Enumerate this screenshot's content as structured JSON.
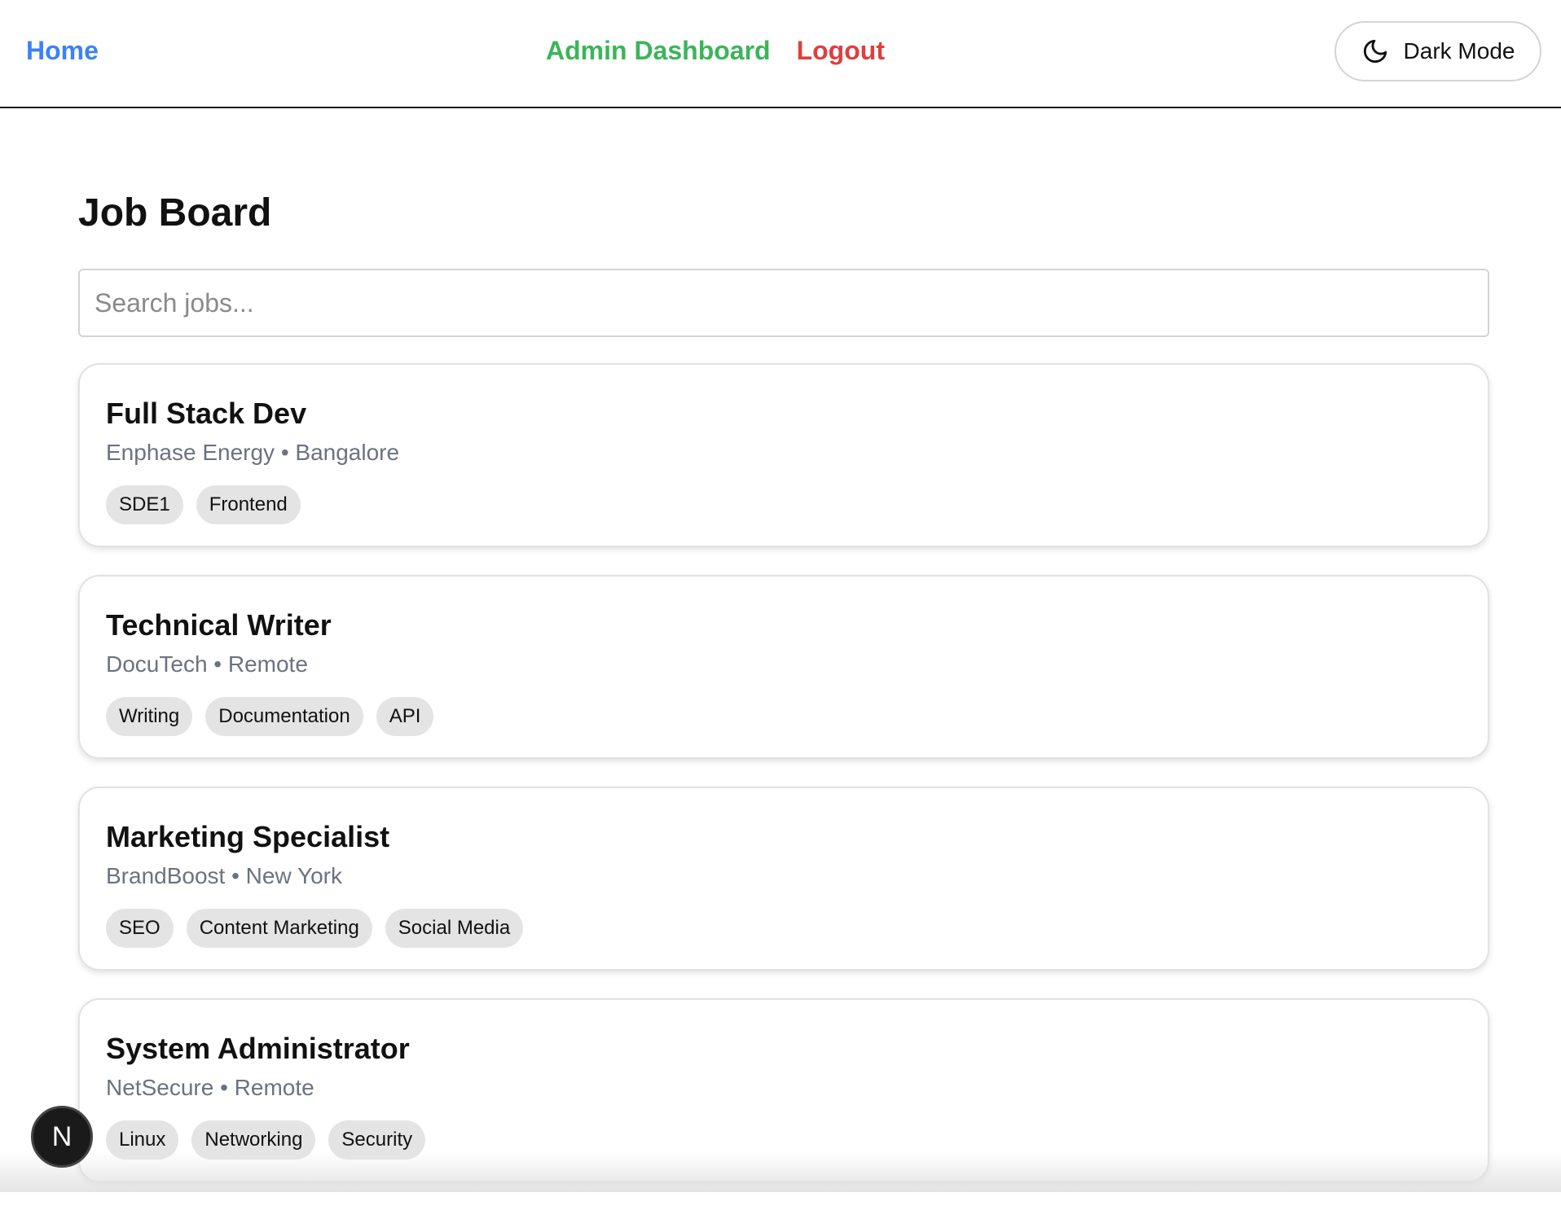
{
  "nav": {
    "home_label": "Home",
    "admin_label": "Admin Dashboard",
    "logout_label": "Logout",
    "dark_mode_label": "Dark Mode",
    "dark_mode_icon": "moon-icon"
  },
  "colors": {
    "home": "#3b82f6",
    "admin": "#3cb55a",
    "logout": "#e03e3e",
    "meta_text": "#6b7280",
    "tag_bg": "#e4e4e4"
  },
  "page": {
    "title": "Job Board"
  },
  "search": {
    "placeholder": "Search jobs...",
    "value": ""
  },
  "jobs": [
    {
      "title": "Full Stack Dev",
      "company": "Enphase Energy",
      "location": "Bangalore",
      "meta": "Enphase Energy • Bangalore",
      "tags": [
        "SDE1",
        "Frontend"
      ]
    },
    {
      "title": "Technical Writer",
      "company": "DocuTech",
      "location": "Remote",
      "meta": "DocuTech • Remote",
      "tags": [
        "Writing",
        "Documentation",
        "API"
      ]
    },
    {
      "title": "Marketing Specialist",
      "company": "BrandBoost",
      "location": "New York",
      "meta": "BrandBoost • New York",
      "tags": [
        "SEO",
        "Content Marketing",
        "Social Media"
      ]
    },
    {
      "title": "System Administrator",
      "company": "NetSecure",
      "location": "Remote",
      "meta": "NetSecure • Remote",
      "tags": [
        "Linux",
        "Networking",
        "Security"
      ]
    }
  ],
  "dev_badge": {
    "label": "N",
    "icon": "nextjs-icon"
  }
}
